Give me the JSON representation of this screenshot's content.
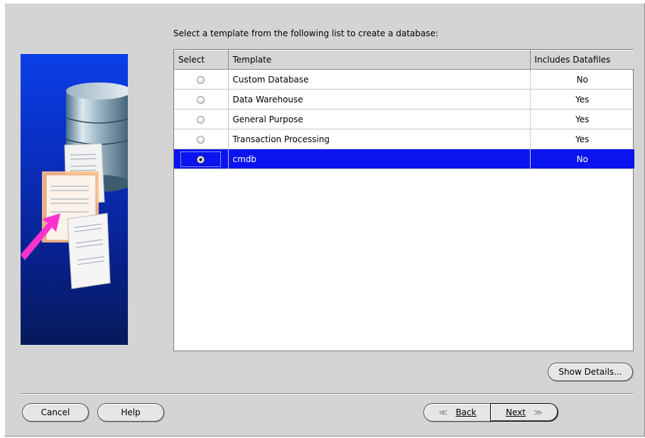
{
  "instruction": "Select a template from the following list to create a database:",
  "table": {
    "headers": [
      "Select",
      "Template",
      "Includes Datafiles"
    ],
    "rows": [
      {
        "template": "Custom Database",
        "includes": "No",
        "selected": false
      },
      {
        "template": "Data Warehouse",
        "includes": "Yes",
        "selected": false
      },
      {
        "template": "General Purpose",
        "includes": "Yes",
        "selected": false
      },
      {
        "template": "Transaction Processing",
        "includes": "Yes",
        "selected": false
      },
      {
        "template": "cmdb",
        "includes": "No",
        "selected": true
      }
    ]
  },
  "buttons": {
    "show_details": "Show Details...",
    "cancel": "Cancel",
    "help": "Help",
    "back": "Back",
    "next": "Next"
  },
  "colors": {
    "selection": "#0a14ee",
    "panel_bg": "#d4d4d4",
    "art_blue": "#0b3fe8"
  },
  "icons": {
    "back": "chevron-left-icon",
    "next": "chevron-right-icon"
  }
}
